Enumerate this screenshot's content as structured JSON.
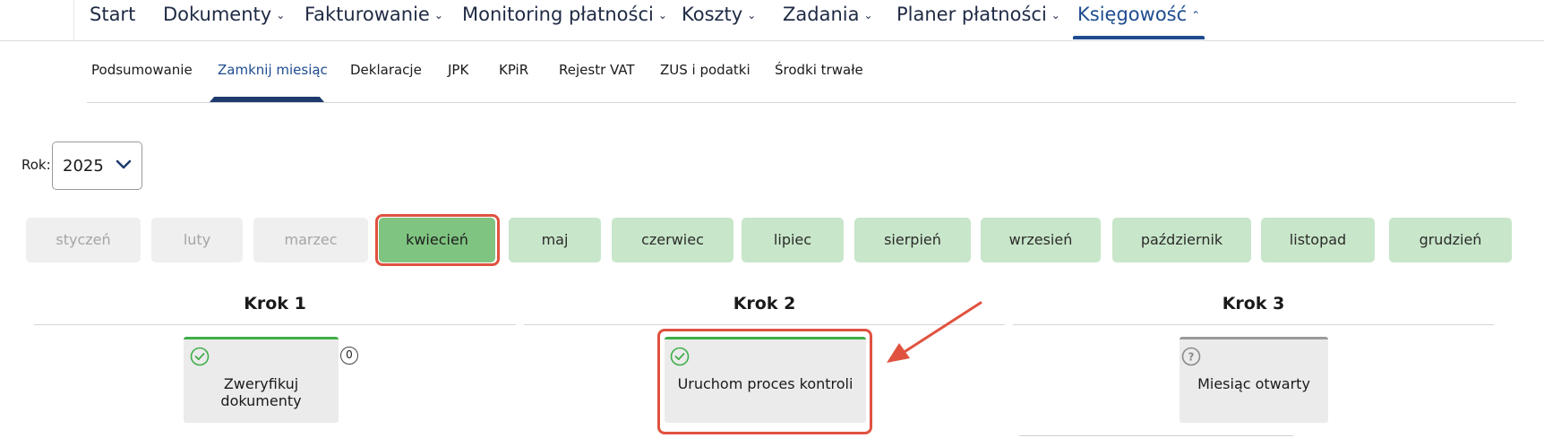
{
  "top_nav": {
    "items": [
      {
        "label": "Start",
        "chevron": ""
      },
      {
        "label": "Dokumenty",
        "chevron": "⌄"
      },
      {
        "label": "Fakturowanie",
        "chevron": "⌄"
      },
      {
        "label": "Monitoring płatności",
        "chevron": "⌄"
      },
      {
        "label": "Koszty",
        "chevron": "⌄"
      },
      {
        "label": "Zadania",
        "chevron": "⌄"
      },
      {
        "label": "Planer płatności",
        "chevron": "⌄"
      },
      {
        "label": "Księgowość",
        "chevron": "⌃"
      }
    ],
    "active": "Księgowość"
  },
  "sub_nav": {
    "items": [
      {
        "label": "Podsumowanie"
      },
      {
        "label": "Zamknij miesiąc"
      },
      {
        "label": "Deklaracje"
      },
      {
        "label": "JPK"
      },
      {
        "label": "KPiR"
      },
      {
        "label": "Rejestr VAT"
      },
      {
        "label": "ZUS i podatki"
      },
      {
        "label": "Środki trwałe"
      }
    ],
    "active": "Zamknij miesiąc"
  },
  "year": {
    "label": "Rok:",
    "value": "2025",
    "icon": "chevron-down-icon"
  },
  "months": [
    {
      "label": "styczeń",
      "state": "disabled"
    },
    {
      "label": "luty",
      "state": "disabled"
    },
    {
      "label": "marzec",
      "state": "disabled"
    },
    {
      "label": "kwiecień",
      "state": "selected"
    },
    {
      "label": "maj",
      "state": "future"
    },
    {
      "label": "czerwiec",
      "state": "future"
    },
    {
      "label": "lipiec",
      "state": "future"
    },
    {
      "label": "sierpień",
      "state": "future"
    },
    {
      "label": "wrzesień",
      "state": "future"
    },
    {
      "label": "październik",
      "state": "future"
    },
    {
      "label": "listopad",
      "state": "future"
    },
    {
      "label": "grudzień",
      "state": "future"
    }
  ],
  "steps": [
    {
      "title": "Krok 1",
      "card_label": "Zweryfikuj dokumenty",
      "status_icon": "check-circle-icon",
      "status": "done",
      "badge": "0"
    },
    {
      "title": "Krok 2",
      "card_label": "Uruchom proces kontroli",
      "status_icon": "check-circle-icon",
      "status": "done"
    },
    {
      "title": "Krok 3",
      "card_label": "Miesiąc otwarty",
      "status_icon": "question-circle-icon",
      "status": "open"
    }
  ],
  "colors": {
    "accent": "#1e4c8f",
    "annotation": "#e0523f",
    "month_selected": "#7fc481",
    "month_future": "#c8e6c9",
    "month_disabled": "#efefef",
    "done_green": "#3fae49"
  }
}
